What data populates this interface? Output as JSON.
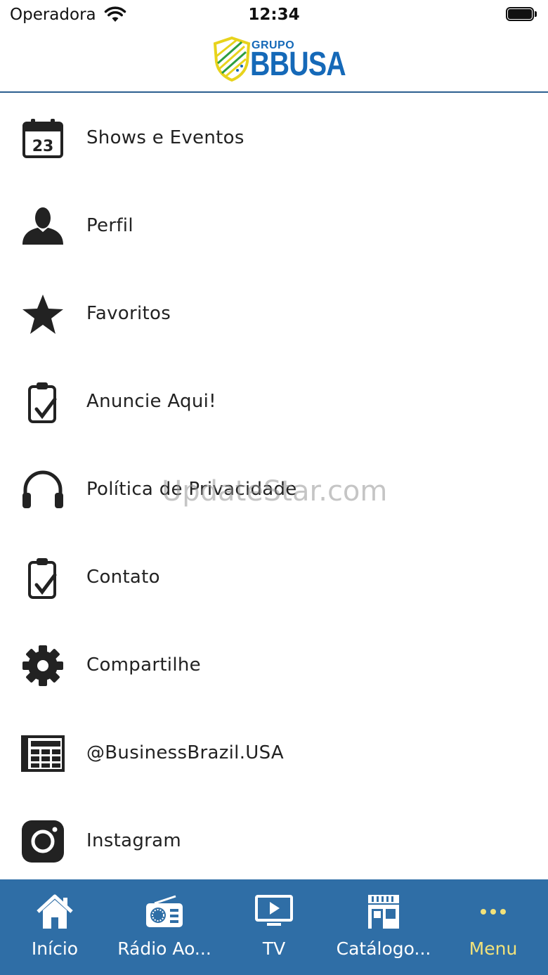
{
  "status_bar": {
    "carrier": "Operadora",
    "time": "12:34"
  },
  "header": {
    "logo_small": "GRUPO",
    "logo_big": "BBUSA"
  },
  "menu": {
    "items": [
      {
        "label": "Shows e Eventos",
        "icon": "calendar-icon",
        "calendar_day": "23"
      },
      {
        "label": "Perfil",
        "icon": "person-icon"
      },
      {
        "label": "Favoritos",
        "icon": "star-icon"
      },
      {
        "label": "Anuncie Aqui!",
        "icon": "clipboard-check-icon"
      },
      {
        "label": "Política de Privacidade",
        "icon": "headphones-icon"
      },
      {
        "label": "Contato",
        "icon": "clipboard-check-icon"
      },
      {
        "label": "Compartilhe",
        "icon": "gear-icon"
      },
      {
        "label": "@BusinessBrazil.USA",
        "icon": "newspaper-icon"
      },
      {
        "label": "Instagram",
        "icon": "instagram-icon"
      }
    ]
  },
  "watermark": "UpdateStar.com",
  "tabbar": {
    "tabs": [
      {
        "label": "Início",
        "icon": "home-icon"
      },
      {
        "label": "Rádio Ao...",
        "icon": "radio-icon"
      },
      {
        "label": "TV",
        "icon": "tv-play-icon"
      },
      {
        "label": "Catálogo...",
        "icon": "storefront-icon"
      },
      {
        "label": "Menu",
        "icon": "more-dots-icon",
        "active": true
      }
    ]
  },
  "colors": {
    "tabbar_bg": "#2f6ea6",
    "tab_active": "#f2e27a",
    "header_line": "#2b5f8f",
    "logo_blue": "#1569b8",
    "logo_yellow": "#e8d31c",
    "logo_green": "#2e9e3f"
  }
}
